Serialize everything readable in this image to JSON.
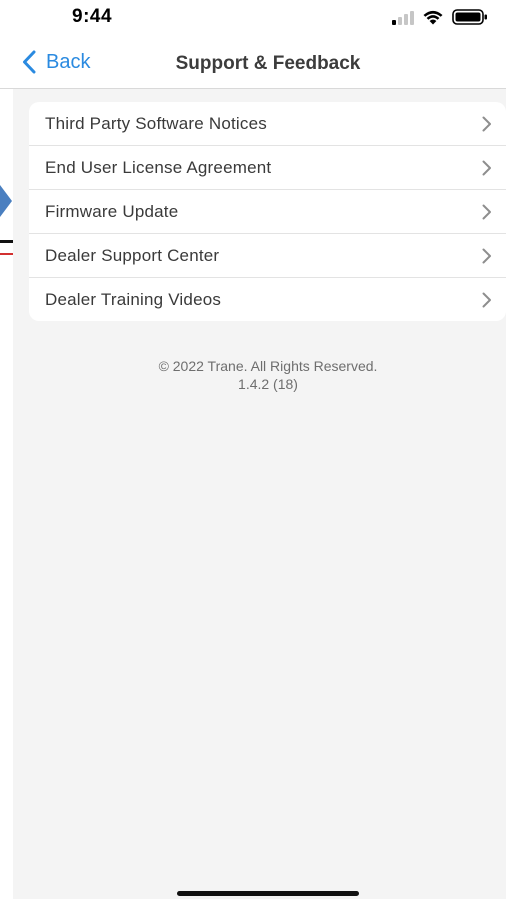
{
  "status_bar": {
    "time": "9:44"
  },
  "nav": {
    "back_label": "Back",
    "title": "Support & Feedback"
  },
  "menu": {
    "items": [
      {
        "label": "Third Party Software Notices"
      },
      {
        "label": "End User License Agreement"
      },
      {
        "label": "Firmware Update"
      },
      {
        "label": "Dealer Support Center"
      },
      {
        "label": "Dealer Training Videos"
      }
    ]
  },
  "footer": {
    "copyright": "© 2022 Trane. All Rights Reserved.",
    "version": "1.4.2 (18)"
  },
  "colors": {
    "accent": "#2a8ae0",
    "background": "#f4f4f4",
    "card": "#ffffff"
  },
  "icons": {
    "back": "chevron-left-icon",
    "row": "chevron-right-icon",
    "signal": "signal-icon",
    "wifi": "wifi-icon",
    "battery": "battery-icon"
  }
}
